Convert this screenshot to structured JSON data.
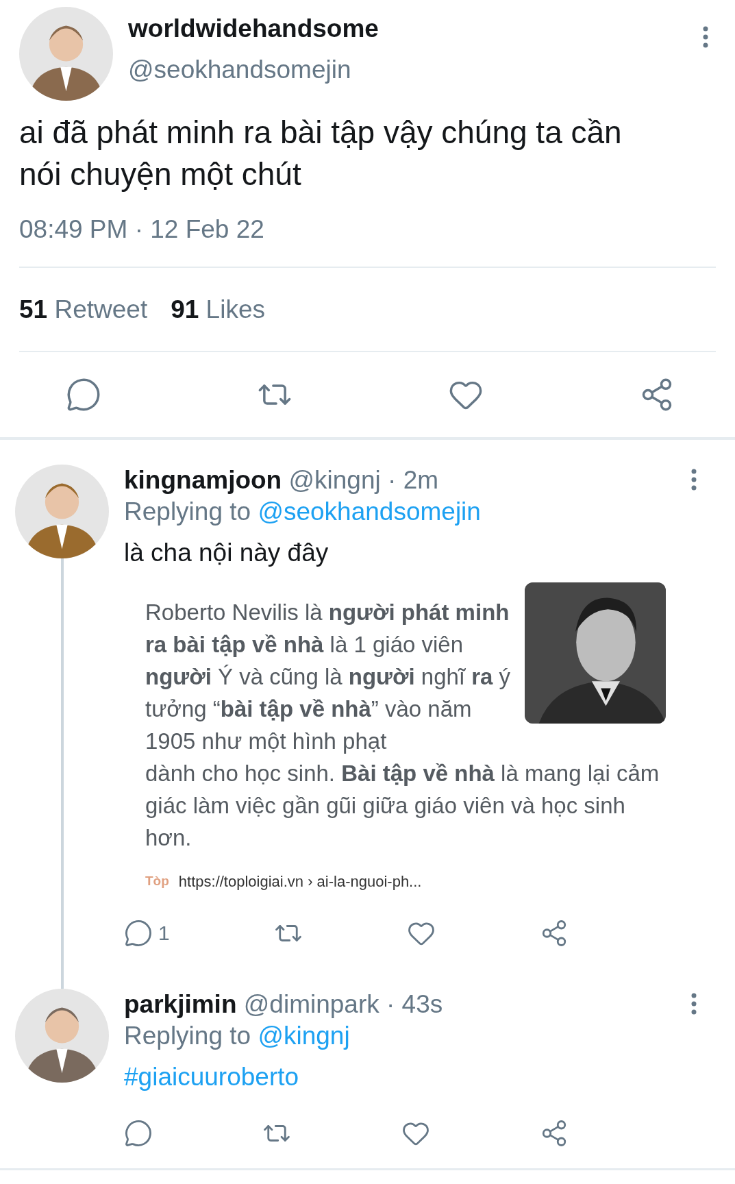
{
  "tweet": {
    "display_name": "worldwidehandsome",
    "handle": "@seokhandsomejin",
    "text": "ai đã phát minh ra bài tập vậy chúng ta cần nói chuyện một chút",
    "timestamp": "08:49 PM · 12 Feb 22",
    "stats": [
      {
        "count": "51",
        "label": "Retweet"
      },
      {
        "count": "91",
        "label": "Likes"
      }
    ]
  },
  "replies": [
    {
      "display_name": "kingnamjoon",
      "meta": "@kingnj · 2m",
      "replying_label": "Replying to",
      "replying_to": "@seokhandsomejin",
      "body": {
        "kind": "plain",
        "text": "là cha nội này đây"
      },
      "thread_line": true,
      "card": {
        "text_beside_picture": "Roberto Nevilis là **người phát minh ra bài tập về nhà** là 1 giáo viên **người** Ý và cũng là **người** nghĩ **ra** ý tưởng “**bài tập về nhà**” vào năm 1905 như một hình phạt",
        "text_below_picture": "dành cho học sinh. **Bài tập về nhà** là mang lại cảm giác làm việc gần gũi giữa giáo viên và học sinh hơn.",
        "source_logo": "Tòp",
        "source_url": "https://toploigiai.vn › ai-la-nguoi-ph..."
      },
      "reply_count": "1"
    },
    {
      "display_name": "parkjimin",
      "meta": "@diminpark · 43s",
      "replying_label": "Replying to",
      "replying_to": "@kingnj",
      "body": {
        "kind": "hashtag",
        "text": "#giaicuuroberto"
      },
      "thread_line": false
    }
  ]
}
